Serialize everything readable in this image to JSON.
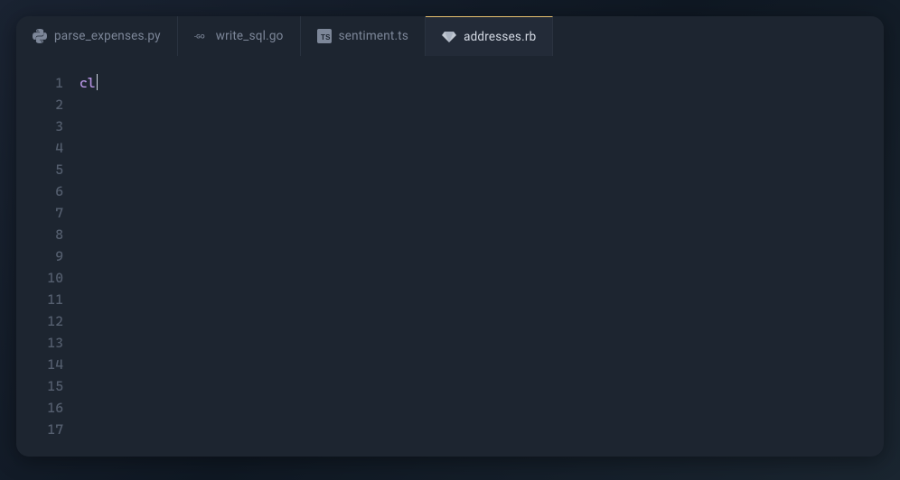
{
  "tabs": [
    {
      "label": "parse_expenses.py",
      "icon": "python",
      "active": false
    },
    {
      "label": "write_sql.go",
      "icon": "go",
      "active": false
    },
    {
      "label": "sentiment.ts",
      "icon": "ts",
      "active": false
    },
    {
      "label": "addresses.rb",
      "icon": "ruby",
      "active": true
    }
  ],
  "editor": {
    "line_numbers": [
      "1",
      "2",
      "3",
      "4",
      "5",
      "6",
      "7",
      "8",
      "9",
      "10",
      "11",
      "12",
      "13",
      "14",
      "15",
      "16",
      "17"
    ],
    "code_lines": [
      {
        "tokens": [
          {
            "text": "cl",
            "class": "tok-keyword"
          }
        ],
        "cursor": true
      },
      {
        "tokens": []
      },
      {
        "tokens": []
      },
      {
        "tokens": []
      },
      {
        "tokens": []
      },
      {
        "tokens": []
      },
      {
        "tokens": []
      },
      {
        "tokens": []
      },
      {
        "tokens": []
      },
      {
        "tokens": []
      },
      {
        "tokens": []
      },
      {
        "tokens": []
      },
      {
        "tokens": []
      },
      {
        "tokens": []
      },
      {
        "tokens": []
      },
      {
        "tokens": []
      },
      {
        "tokens": []
      }
    ]
  },
  "colors": {
    "bg_editor": "#1d2530",
    "fg_gutter": "#555f6f",
    "fg_text": "#c8d0dc",
    "fg_muted": "#7d8799",
    "accent_tab": "#e8c170",
    "keyword": "#b795e4"
  }
}
